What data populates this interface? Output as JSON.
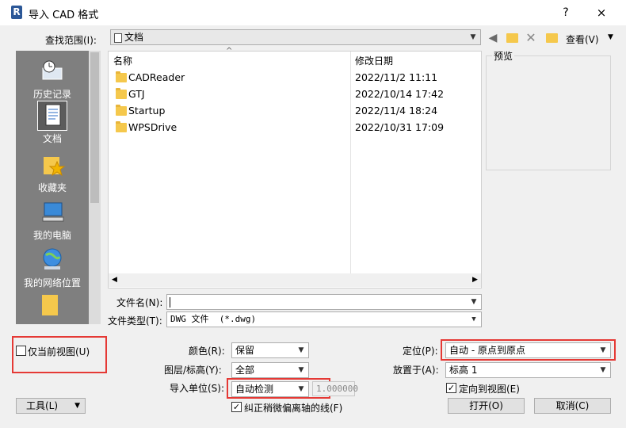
{
  "window": {
    "title": "导入 CAD 格式",
    "app_logo": "R",
    "help": "?",
    "close": "×"
  },
  "toolbar": {
    "lookin_label": "查找范围(I):",
    "lookin_value": "文档",
    "view_label": "查看(V)",
    "icons": [
      "back-arrow-icon",
      "up-folder-icon",
      "delete-icon",
      "new-folder-icon",
      "view-menu-icon"
    ]
  },
  "places": [
    {
      "label": "历史记录",
      "icon": "history-icon"
    },
    {
      "label": "文档",
      "icon": "documents-icon"
    },
    {
      "label": "收藏夹",
      "icon": "favorites-icon"
    },
    {
      "label": "我的电脑",
      "icon": "computer-icon"
    },
    {
      "label": "我的网络位置",
      "icon": "network-icon"
    }
  ],
  "filelist": {
    "columns": [
      "名称",
      "修改日期"
    ],
    "rows": [
      {
        "name": "CADReader",
        "date": "2022/11/2 11:11"
      },
      {
        "name": "GTJ",
        "date": "2022/10/14 17:42"
      },
      {
        "name": "Startup",
        "date": "2022/11/4 18:24"
      },
      {
        "name": "WPSDrive",
        "date": "2022/10/31 17:09"
      }
    ]
  },
  "preview": {
    "label": "预览"
  },
  "filename": {
    "label": "文件名(N):",
    "value": ""
  },
  "filetype": {
    "label": "文件类型(T):",
    "value": "DWG 文件  (*.dwg)"
  },
  "options": {
    "current_view_only": {
      "label": "仅当前视图(U)",
      "checked": false
    },
    "color": {
      "label": "颜色(R):",
      "value": "保留"
    },
    "layers": {
      "label": "图层/标高(Y):",
      "value": "全部"
    },
    "import_units": {
      "label": "导入单位(S):",
      "value": "自动检测",
      "factor": "1.000000"
    },
    "correct_lines": {
      "label": "纠正稍微偏离轴的线(F)",
      "checked": true
    },
    "positioning": {
      "label": "定位(P):",
      "value": "自动 - 原点到原点"
    },
    "place_at": {
      "label": "放置于(A):",
      "value": "标高 1"
    },
    "orient_to_view": {
      "label": "定向到视图(E)",
      "checked": true
    }
  },
  "buttons": {
    "tools": "工具(L)",
    "open": "打开(O)",
    "cancel": "取消(C)"
  },
  "colors": {
    "highlight": "#e53935",
    "places_bg": "#7f7f7f"
  }
}
